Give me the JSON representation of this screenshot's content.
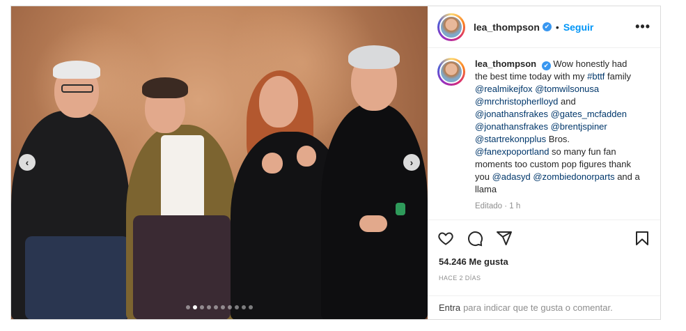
{
  "post": {
    "user": {
      "username": "lea_thompson",
      "verified_mark": "✔",
      "separator": "•",
      "follow_label": "Seguir",
      "more_label": "•••",
      "avatar": "user-avatar"
    },
    "caption": {
      "username": "lea_thompson",
      "segments": [
        {
          "text": "Wow honestly had the best time today with my ",
          "link": false
        },
        {
          "text": "#bttf",
          "link": true
        },
        {
          "text": " family ",
          "link": false
        },
        {
          "text": "@realmikejfox",
          "link": true
        },
        {
          "text": " ",
          "link": false
        },
        {
          "text": "@tomwilsonusa",
          "link": true
        },
        {
          "text": " ",
          "link": false
        },
        {
          "text": "@mrchristopherlloyd",
          "link": true
        },
        {
          "text": " and ",
          "link": false
        },
        {
          "text": "@jonathansfrakes",
          "link": true
        },
        {
          "text": " ",
          "link": false
        },
        {
          "text": "@gates_mcfadden",
          "link": true
        },
        {
          "text": " ",
          "link": false
        },
        {
          "text": "@jonathansfrakes",
          "link": true
        },
        {
          "text": " ",
          "link": false
        },
        {
          "text": "@brentjspiner",
          "link": true
        },
        {
          "text": " ",
          "link": false
        },
        {
          "text": "@startrekonpplus",
          "link": true
        },
        {
          "text": " Bros. ",
          "link": false
        },
        {
          "text": "@fanexpoportland",
          "link": true
        },
        {
          "text": " so many fun fan moments too custom pop figures thank you ",
          "link": false
        },
        {
          "text": "@adasyd",
          "link": true
        },
        {
          "text": " ",
          "link": false
        },
        {
          "text": "@zombiedonorparts",
          "link": true
        },
        {
          "text": " and a llama",
          "link": false
        }
      ],
      "meta": "Editado · 1 h"
    },
    "media": {
      "prev_label": "‹",
      "next_label": "›",
      "dot_count": 10,
      "active_dot": 1
    },
    "actions": {
      "like_icon": "heart-icon",
      "comment_icon": "comment-icon",
      "share_icon": "share-icon",
      "save_icon": "bookmark-icon"
    },
    "likes_text": "54.246 Me gusta",
    "time_text": "HACE 2 DÍAS",
    "comment_box": {
      "entra_label": "Entra",
      "prompt": "para indicar que te gusta o comentar."
    }
  }
}
